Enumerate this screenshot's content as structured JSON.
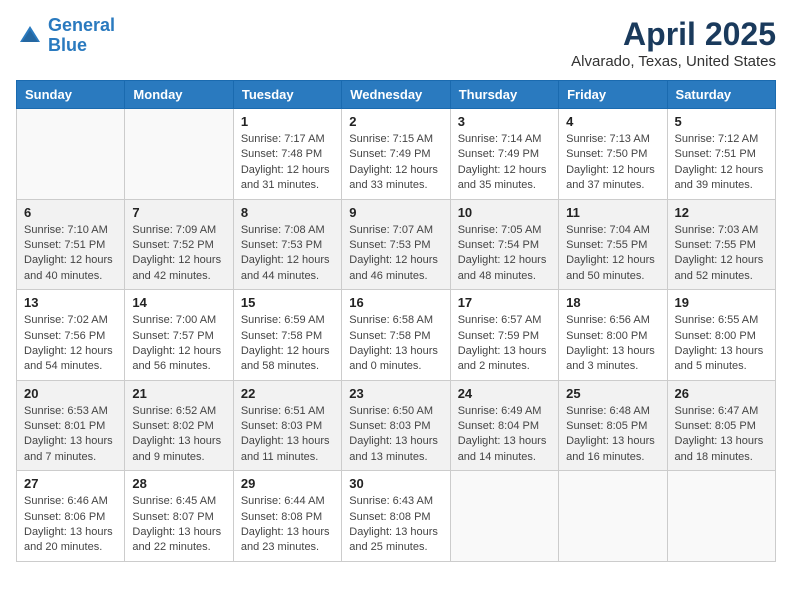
{
  "header": {
    "logo_line1": "General",
    "logo_line2": "Blue",
    "month": "April 2025",
    "location": "Alvarado, Texas, United States"
  },
  "weekdays": [
    "Sunday",
    "Monday",
    "Tuesday",
    "Wednesday",
    "Thursday",
    "Friday",
    "Saturday"
  ],
  "weeks": [
    [
      {
        "day": "",
        "info": ""
      },
      {
        "day": "",
        "info": ""
      },
      {
        "day": "1",
        "info": "Sunrise: 7:17 AM\nSunset: 7:48 PM\nDaylight: 12 hours and 31 minutes."
      },
      {
        "day": "2",
        "info": "Sunrise: 7:15 AM\nSunset: 7:49 PM\nDaylight: 12 hours and 33 minutes."
      },
      {
        "day": "3",
        "info": "Sunrise: 7:14 AM\nSunset: 7:49 PM\nDaylight: 12 hours and 35 minutes."
      },
      {
        "day": "4",
        "info": "Sunrise: 7:13 AM\nSunset: 7:50 PM\nDaylight: 12 hours and 37 minutes."
      },
      {
        "day": "5",
        "info": "Sunrise: 7:12 AM\nSunset: 7:51 PM\nDaylight: 12 hours and 39 minutes."
      }
    ],
    [
      {
        "day": "6",
        "info": "Sunrise: 7:10 AM\nSunset: 7:51 PM\nDaylight: 12 hours and 40 minutes."
      },
      {
        "day": "7",
        "info": "Sunrise: 7:09 AM\nSunset: 7:52 PM\nDaylight: 12 hours and 42 minutes."
      },
      {
        "day": "8",
        "info": "Sunrise: 7:08 AM\nSunset: 7:53 PM\nDaylight: 12 hours and 44 minutes."
      },
      {
        "day": "9",
        "info": "Sunrise: 7:07 AM\nSunset: 7:53 PM\nDaylight: 12 hours and 46 minutes."
      },
      {
        "day": "10",
        "info": "Sunrise: 7:05 AM\nSunset: 7:54 PM\nDaylight: 12 hours and 48 minutes."
      },
      {
        "day": "11",
        "info": "Sunrise: 7:04 AM\nSunset: 7:55 PM\nDaylight: 12 hours and 50 minutes."
      },
      {
        "day": "12",
        "info": "Sunrise: 7:03 AM\nSunset: 7:55 PM\nDaylight: 12 hours and 52 minutes."
      }
    ],
    [
      {
        "day": "13",
        "info": "Sunrise: 7:02 AM\nSunset: 7:56 PM\nDaylight: 12 hours and 54 minutes."
      },
      {
        "day": "14",
        "info": "Sunrise: 7:00 AM\nSunset: 7:57 PM\nDaylight: 12 hours and 56 minutes."
      },
      {
        "day": "15",
        "info": "Sunrise: 6:59 AM\nSunset: 7:58 PM\nDaylight: 12 hours and 58 minutes."
      },
      {
        "day": "16",
        "info": "Sunrise: 6:58 AM\nSunset: 7:58 PM\nDaylight: 13 hours and 0 minutes."
      },
      {
        "day": "17",
        "info": "Sunrise: 6:57 AM\nSunset: 7:59 PM\nDaylight: 13 hours and 2 minutes."
      },
      {
        "day": "18",
        "info": "Sunrise: 6:56 AM\nSunset: 8:00 PM\nDaylight: 13 hours and 3 minutes."
      },
      {
        "day": "19",
        "info": "Sunrise: 6:55 AM\nSunset: 8:00 PM\nDaylight: 13 hours and 5 minutes."
      }
    ],
    [
      {
        "day": "20",
        "info": "Sunrise: 6:53 AM\nSunset: 8:01 PM\nDaylight: 13 hours and 7 minutes."
      },
      {
        "day": "21",
        "info": "Sunrise: 6:52 AM\nSunset: 8:02 PM\nDaylight: 13 hours and 9 minutes."
      },
      {
        "day": "22",
        "info": "Sunrise: 6:51 AM\nSunset: 8:03 PM\nDaylight: 13 hours and 11 minutes."
      },
      {
        "day": "23",
        "info": "Sunrise: 6:50 AM\nSunset: 8:03 PM\nDaylight: 13 hours and 13 minutes."
      },
      {
        "day": "24",
        "info": "Sunrise: 6:49 AM\nSunset: 8:04 PM\nDaylight: 13 hours and 14 minutes."
      },
      {
        "day": "25",
        "info": "Sunrise: 6:48 AM\nSunset: 8:05 PM\nDaylight: 13 hours and 16 minutes."
      },
      {
        "day": "26",
        "info": "Sunrise: 6:47 AM\nSunset: 8:05 PM\nDaylight: 13 hours and 18 minutes."
      }
    ],
    [
      {
        "day": "27",
        "info": "Sunrise: 6:46 AM\nSunset: 8:06 PM\nDaylight: 13 hours and 20 minutes."
      },
      {
        "day": "28",
        "info": "Sunrise: 6:45 AM\nSunset: 8:07 PM\nDaylight: 13 hours and 22 minutes."
      },
      {
        "day": "29",
        "info": "Sunrise: 6:44 AM\nSunset: 8:08 PM\nDaylight: 13 hours and 23 minutes."
      },
      {
        "day": "30",
        "info": "Sunrise: 6:43 AM\nSunset: 8:08 PM\nDaylight: 13 hours and 25 minutes."
      },
      {
        "day": "",
        "info": ""
      },
      {
        "day": "",
        "info": ""
      },
      {
        "day": "",
        "info": ""
      }
    ]
  ]
}
